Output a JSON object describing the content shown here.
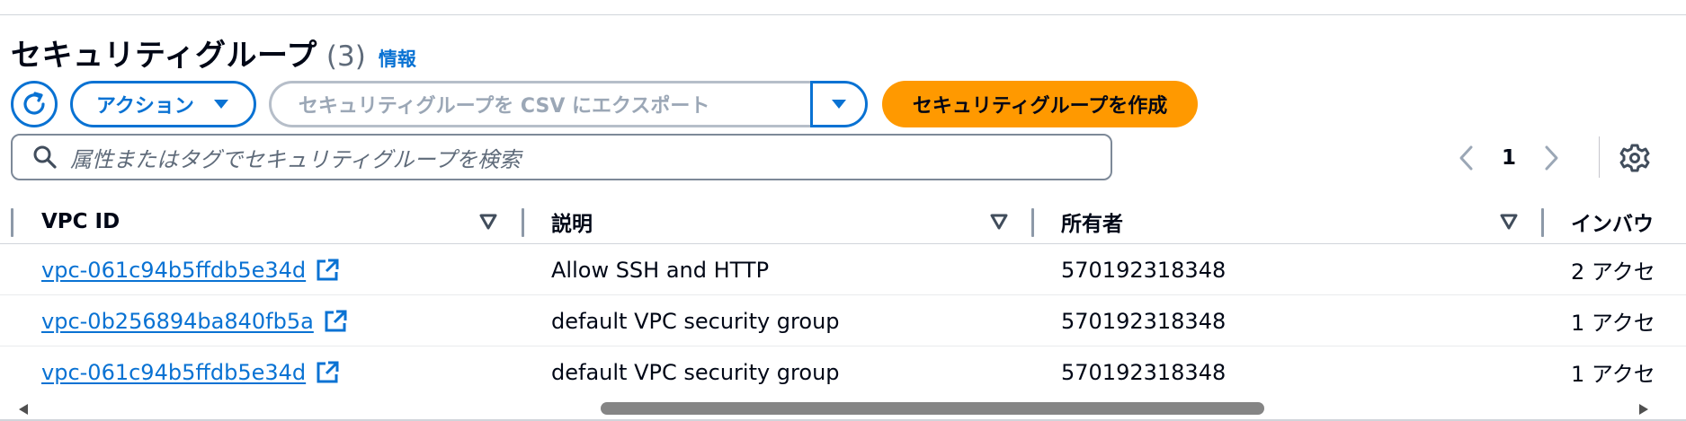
{
  "header": {
    "title": "セキュリティグループ",
    "count": "(3)",
    "info_link": "情報"
  },
  "toolbar": {
    "refresh_icon": "refresh-icon",
    "actions_label": "アクション",
    "export_label": "セキュリティグループを CSV にエクスポート",
    "create_label": "セキュリティグループを作成"
  },
  "search": {
    "placeholder": "属性またはタグでセキュリティグループを検索"
  },
  "pagination": {
    "current_page": "1"
  },
  "table": {
    "columns": [
      {
        "label": "VPC ID"
      },
      {
        "label": "説明"
      },
      {
        "label": "所有者"
      },
      {
        "label": "インバウ"
      }
    ],
    "rows": [
      {
        "vpc_id": "vpc-061c94b5ffdb5e34d",
        "description": "Allow SSH and HTTP",
        "owner": "570192318348",
        "inbound": "2 アクセ"
      },
      {
        "vpc_id": "vpc-0b256894ba840fb5a",
        "description": "default VPC security group",
        "owner": "570192318348",
        "inbound": "1 アクセ"
      },
      {
        "vpc_id": "vpc-061c94b5ffdb5e34d",
        "description": "default VPC security group",
        "owner": "570192318348",
        "inbound": "1 アクセ"
      }
    ]
  },
  "colors": {
    "link": "#0972d3",
    "primary_button": "#ff9900",
    "text": "#000716",
    "muted": "#5f6b7a"
  }
}
